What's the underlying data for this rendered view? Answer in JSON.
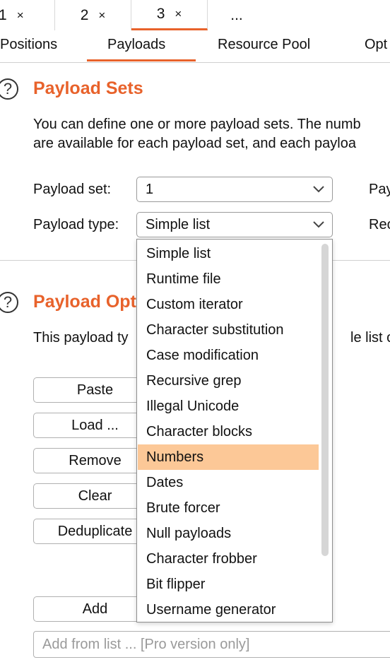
{
  "top_tabs": [
    {
      "num": "1",
      "close": "×"
    },
    {
      "num": "2",
      "close": "×"
    },
    {
      "num": "3",
      "close": "×"
    },
    {
      "num": "..."
    }
  ],
  "sub_tabs": [
    "Positions",
    "Payloads",
    "Resource Pool",
    "Opt"
  ],
  "active_sub_tab": "Payloads",
  "accent_color": "#e8622b",
  "highlight_color": "#fcc897",
  "payload_sets": {
    "help_glyph": "?",
    "title": "Payload Sets",
    "desc_line1": "You can define one or more payload sets. The numb",
    "desc_line2": "are available for each payload set, and each payloa",
    "set_label": "Payload set:",
    "set_value": "1",
    "type_label": "Payload type:",
    "type_value": "Simple list",
    "right_label1": "Pay",
    "right_label2": "Rec"
  },
  "payload_options": {
    "help_glyph": "?",
    "title": "Payload Opt",
    "desc_left": "This payload ty",
    "desc_right": "le list of s",
    "buttons": [
      "Paste",
      "Load ...",
      "Remove",
      "Clear",
      "Deduplicate"
    ],
    "add_button": "Add",
    "add_from_list_placeholder": "Add from list ... [Pro version only]"
  },
  "dropdown": {
    "options": [
      "Simple list",
      "Runtime file",
      "Custom iterator",
      "Character substitution",
      "Case modification",
      "Recursive grep",
      "Illegal Unicode",
      "Character blocks",
      "Numbers",
      "Dates",
      "Brute forcer",
      "Null payloads",
      "Character frobber",
      "Bit flipper",
      "Username generator"
    ],
    "highlighted": "Numbers"
  }
}
